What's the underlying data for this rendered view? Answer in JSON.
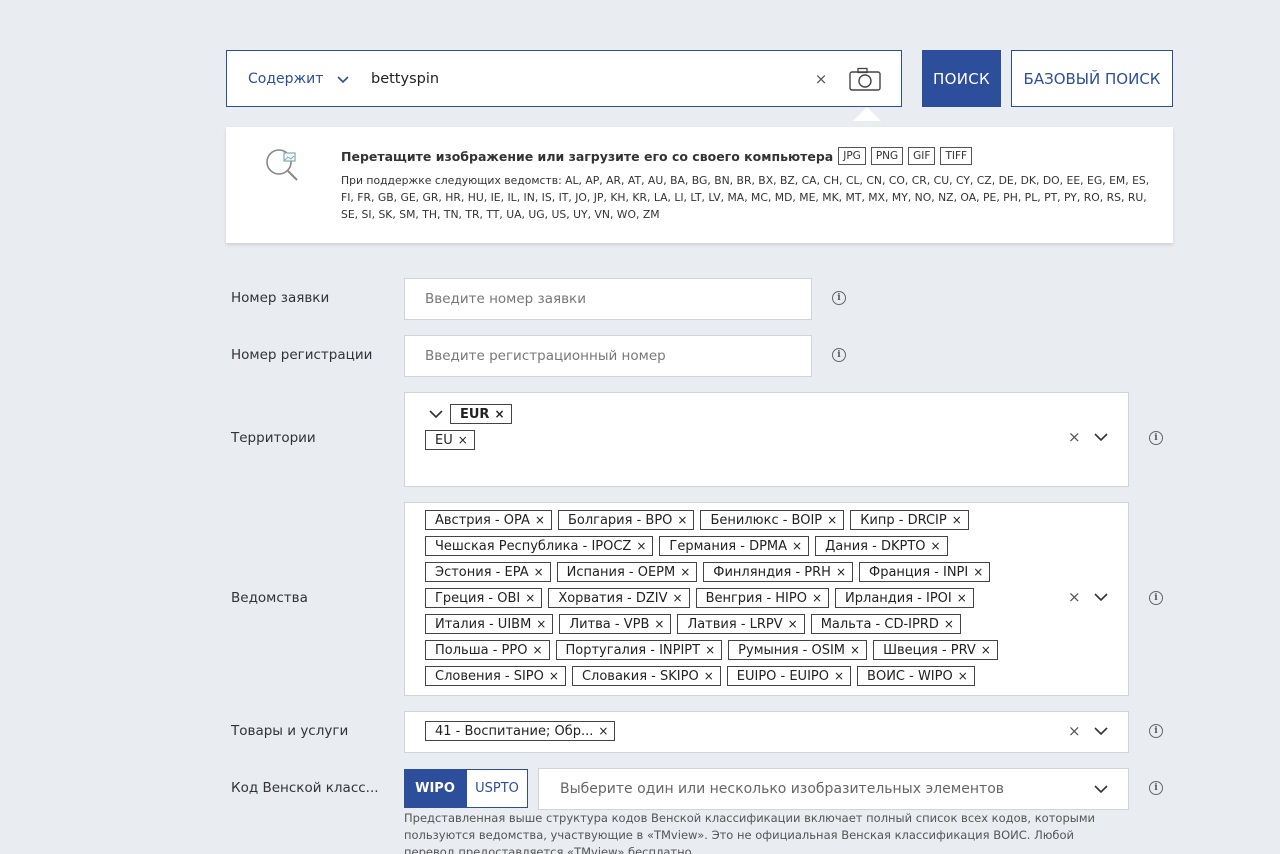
{
  "search": {
    "mode": "Содержит",
    "query": "bettyspin",
    "clear": "×",
    "search_button": "ПОИСК",
    "basic_button": "БАЗОВЫЙ ПОИСК"
  },
  "upload": {
    "title": "Перетащите изображение или загрузите его со своего компьютера",
    "formats": [
      "JPG",
      "PNG",
      "GIF",
      "TIFF"
    ],
    "supported": "При поддержке следующих ведомств: AL, AP, AR, AT, AU, BA, BG, BN, BR, BX, BZ, CA, CH, CL, CN, CO, CR, CU, CY, CZ, DE, DK, DO, EE, EG, EM, ES, FI, FR, GB, GE, GR, HR, HU, IE, IL, IN, IS, IT, JO, JP, KH, KR, LA, LI, LT, LV, MA, MC, MD, ME, MK, MT, MX, MY, NO, NZ, OA, PE, PH, PL, PT, PY, RO, RS, RU, SE, SI, SK, SM, TH, TN, TR, TT, UA, UG, US, UY, VN, WO, ZM"
  },
  "form": {
    "application_number": {
      "label": "Номер заявки",
      "placeholder": "Введите номер заявки"
    },
    "registration_number": {
      "label": "Номер регистрации",
      "placeholder": "Введите регистрационный номер"
    },
    "territories": {
      "label": "Территории",
      "group": "EUR",
      "items": [
        "EU"
      ]
    },
    "offices": {
      "label": "Ведомства",
      "items": [
        "Австрия - OPA",
        "Болгария - BPO",
        "Бенилюкс - BOIP",
        "Кипр - DRCIP",
        "Чешская Республика - IPOCZ",
        "Германия - DPMA",
        "Дания - DKPTO",
        "Эстония - EPA",
        "Испания - OEPM",
        "Финляндия - PRH",
        "Франция - INPI",
        "Греция - OBI",
        "Хорватия - DZIV",
        "Венгрия - HIPO",
        "Ирландия - IPOI",
        "Италия - UIBM",
        "Литва - VPB",
        "Латвия - LRPV",
        "Мальта - CD-IPRD",
        "Польша - PPO",
        "Португалия - INPIPT",
        "Румыния - OSIM",
        "Швеция - PRV",
        "Словения - SIPO",
        "Словакия - SKIPO",
        "EUIPO - EUIPO",
        "ВОИС - WIPO"
      ]
    },
    "goods": {
      "label": "Товары и услуги",
      "items": [
        "41 - Воспитание; Обр..."
      ]
    },
    "vienna": {
      "label": "Код Венской класс...",
      "toggle": [
        "WIPO",
        "USPTO"
      ],
      "active": "WIPO",
      "placeholder": "Выберите один или несколько изобразительных элементов",
      "note": "Представленная выше структура кодов Венской классификации включает полный список всех кодов, которыми пользуются ведомства, участвующие в «TMview». Это не официальная Венская классификация ВОИС. Любой перевод предоставляется «TMview» бесплатно."
    }
  },
  "icons": {
    "info": "i",
    "remove": "×"
  },
  "colors": {
    "accent": "#2d4e9b",
    "background": "#e9ecf1"
  }
}
